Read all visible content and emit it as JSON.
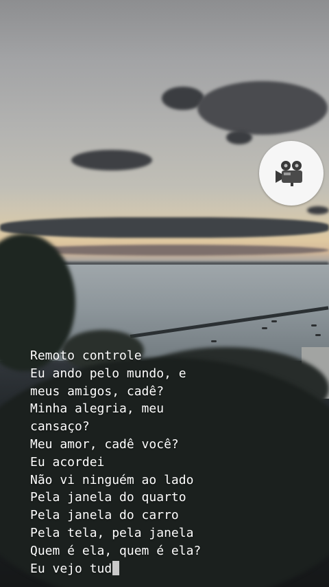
{
  "scene": {
    "description_icon": "movie-camera-icon",
    "colors": {
      "text": "#ffffff",
      "badge": "#f6f6f6",
      "cursor": "#c9c9c9"
    }
  },
  "lyrics": {
    "lines": [
      "Remoto controle",
      "Eu ando pelo mundo, e",
      "meus amigos, cadê?",
      "Minha alegria, meu",
      "cansaço?",
      "Meu amor, cadê você?",
      "Eu acordei",
      "Não vi ninguém ao lado",
      "Pela janela do quarto",
      "Pela janela do carro",
      "Pela tela, pela janela",
      "Quem é ela, quem é ela?"
    ],
    "typing_line": "Eu vejo tud"
  }
}
